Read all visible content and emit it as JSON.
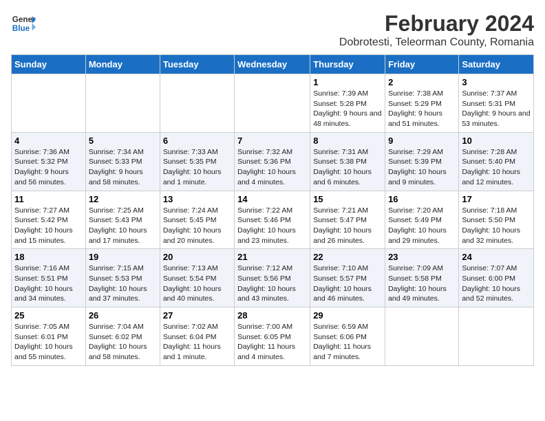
{
  "logo": {
    "line1": "General",
    "line2": "Blue"
  },
  "title": "February 2024",
  "subtitle": "Dobrotesti, Teleorman County, Romania",
  "days_header": [
    "Sunday",
    "Monday",
    "Tuesday",
    "Wednesday",
    "Thursday",
    "Friday",
    "Saturday"
  ],
  "weeks": [
    [
      {
        "day": "",
        "info": ""
      },
      {
        "day": "",
        "info": ""
      },
      {
        "day": "",
        "info": ""
      },
      {
        "day": "",
        "info": ""
      },
      {
        "day": "1",
        "info": "Sunrise: 7:39 AM\nSunset: 5:28 PM\nDaylight: 9 hours and 48 minutes."
      },
      {
        "day": "2",
        "info": "Sunrise: 7:38 AM\nSunset: 5:29 PM\nDaylight: 9 hours and 51 minutes."
      },
      {
        "day": "3",
        "info": "Sunrise: 7:37 AM\nSunset: 5:31 PM\nDaylight: 9 hours and 53 minutes."
      }
    ],
    [
      {
        "day": "4",
        "info": "Sunrise: 7:36 AM\nSunset: 5:32 PM\nDaylight: 9 hours and 56 minutes."
      },
      {
        "day": "5",
        "info": "Sunrise: 7:34 AM\nSunset: 5:33 PM\nDaylight: 9 hours and 58 minutes."
      },
      {
        "day": "6",
        "info": "Sunrise: 7:33 AM\nSunset: 5:35 PM\nDaylight: 10 hours and 1 minute."
      },
      {
        "day": "7",
        "info": "Sunrise: 7:32 AM\nSunset: 5:36 PM\nDaylight: 10 hours and 4 minutes."
      },
      {
        "day": "8",
        "info": "Sunrise: 7:31 AM\nSunset: 5:38 PM\nDaylight: 10 hours and 6 minutes."
      },
      {
        "day": "9",
        "info": "Sunrise: 7:29 AM\nSunset: 5:39 PM\nDaylight: 10 hours and 9 minutes."
      },
      {
        "day": "10",
        "info": "Sunrise: 7:28 AM\nSunset: 5:40 PM\nDaylight: 10 hours and 12 minutes."
      }
    ],
    [
      {
        "day": "11",
        "info": "Sunrise: 7:27 AM\nSunset: 5:42 PM\nDaylight: 10 hours and 15 minutes."
      },
      {
        "day": "12",
        "info": "Sunrise: 7:25 AM\nSunset: 5:43 PM\nDaylight: 10 hours and 17 minutes."
      },
      {
        "day": "13",
        "info": "Sunrise: 7:24 AM\nSunset: 5:45 PM\nDaylight: 10 hours and 20 minutes."
      },
      {
        "day": "14",
        "info": "Sunrise: 7:22 AM\nSunset: 5:46 PM\nDaylight: 10 hours and 23 minutes."
      },
      {
        "day": "15",
        "info": "Sunrise: 7:21 AM\nSunset: 5:47 PM\nDaylight: 10 hours and 26 minutes."
      },
      {
        "day": "16",
        "info": "Sunrise: 7:20 AM\nSunset: 5:49 PM\nDaylight: 10 hours and 29 minutes."
      },
      {
        "day": "17",
        "info": "Sunrise: 7:18 AM\nSunset: 5:50 PM\nDaylight: 10 hours and 32 minutes."
      }
    ],
    [
      {
        "day": "18",
        "info": "Sunrise: 7:16 AM\nSunset: 5:51 PM\nDaylight: 10 hours and 34 minutes."
      },
      {
        "day": "19",
        "info": "Sunrise: 7:15 AM\nSunset: 5:53 PM\nDaylight: 10 hours and 37 minutes."
      },
      {
        "day": "20",
        "info": "Sunrise: 7:13 AM\nSunset: 5:54 PM\nDaylight: 10 hours and 40 minutes."
      },
      {
        "day": "21",
        "info": "Sunrise: 7:12 AM\nSunset: 5:56 PM\nDaylight: 10 hours and 43 minutes."
      },
      {
        "day": "22",
        "info": "Sunrise: 7:10 AM\nSunset: 5:57 PM\nDaylight: 10 hours and 46 minutes."
      },
      {
        "day": "23",
        "info": "Sunrise: 7:09 AM\nSunset: 5:58 PM\nDaylight: 10 hours and 49 minutes."
      },
      {
        "day": "24",
        "info": "Sunrise: 7:07 AM\nSunset: 6:00 PM\nDaylight: 10 hours and 52 minutes."
      }
    ],
    [
      {
        "day": "25",
        "info": "Sunrise: 7:05 AM\nSunset: 6:01 PM\nDaylight: 10 hours and 55 minutes."
      },
      {
        "day": "26",
        "info": "Sunrise: 7:04 AM\nSunset: 6:02 PM\nDaylight: 10 hours and 58 minutes."
      },
      {
        "day": "27",
        "info": "Sunrise: 7:02 AM\nSunset: 6:04 PM\nDaylight: 11 hours and 1 minute."
      },
      {
        "day": "28",
        "info": "Sunrise: 7:00 AM\nSunset: 6:05 PM\nDaylight: 11 hours and 4 minutes."
      },
      {
        "day": "29",
        "info": "Sunrise: 6:59 AM\nSunset: 6:06 PM\nDaylight: 11 hours and 7 minutes."
      },
      {
        "day": "",
        "info": ""
      },
      {
        "day": "",
        "info": ""
      }
    ]
  ]
}
